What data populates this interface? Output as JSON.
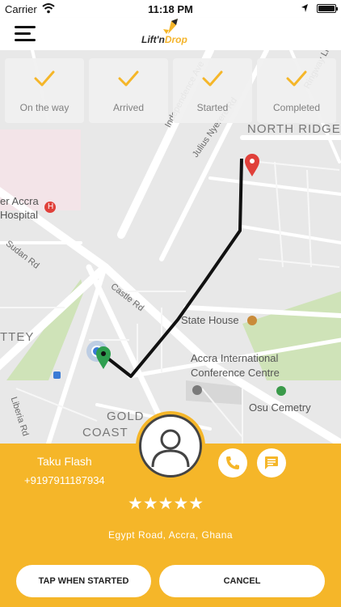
{
  "status_bar": {
    "carrier": "Carrier",
    "time": "11:18 PM"
  },
  "header": {
    "logo_text_main": "Lift'n",
    "logo_text_accent": "Drop"
  },
  "steps": [
    {
      "label": "On the way",
      "done": true
    },
    {
      "label": "Arrived",
      "done": true
    },
    {
      "label": "Started",
      "done": true
    },
    {
      "label": "Completed",
      "done": true
    }
  ],
  "map": {
    "labels": {
      "north_ridge": "NORTH RIDGE",
      "accra_hospital_line1": "er Accra",
      "accra_hospital_line2": "Hospital",
      "sudan_rd": "Sudan Rd",
      "castle_rd": "Castle Rd",
      "state_house": "State House",
      "conference_line1": "Accra International",
      "conference_line2": "Conference Centre",
      "osu_cemetry": "Osu Cemetry",
      "gold": "GOLD",
      "coast": "COAST",
      "ttey": "TTEY",
      "liberia_rd": "Liberia Rd",
      "independence_ave": "Independence Ave",
      "julius_nyerere": "Julius Nyerere Rd",
      "ringway": "Ringway Li",
      "hospital_marker": "H"
    },
    "route_color": "#111111",
    "destination_pin_color": "#e0403a",
    "origin_pin_color": "#2e9e4f",
    "current_location_color": "#3a7bd5"
  },
  "driver": {
    "name": "Taku Flash",
    "phone": "+9197911187934",
    "rating": 5,
    "stars": "★★★★★",
    "address": "Egypt Road, Accra, Ghana"
  },
  "actions": {
    "started_label": "TAP WHEN STARTED",
    "cancel_label": "CANCEL"
  },
  "colors": {
    "accent": "#f5b629",
    "step_check": "#f5b629"
  }
}
